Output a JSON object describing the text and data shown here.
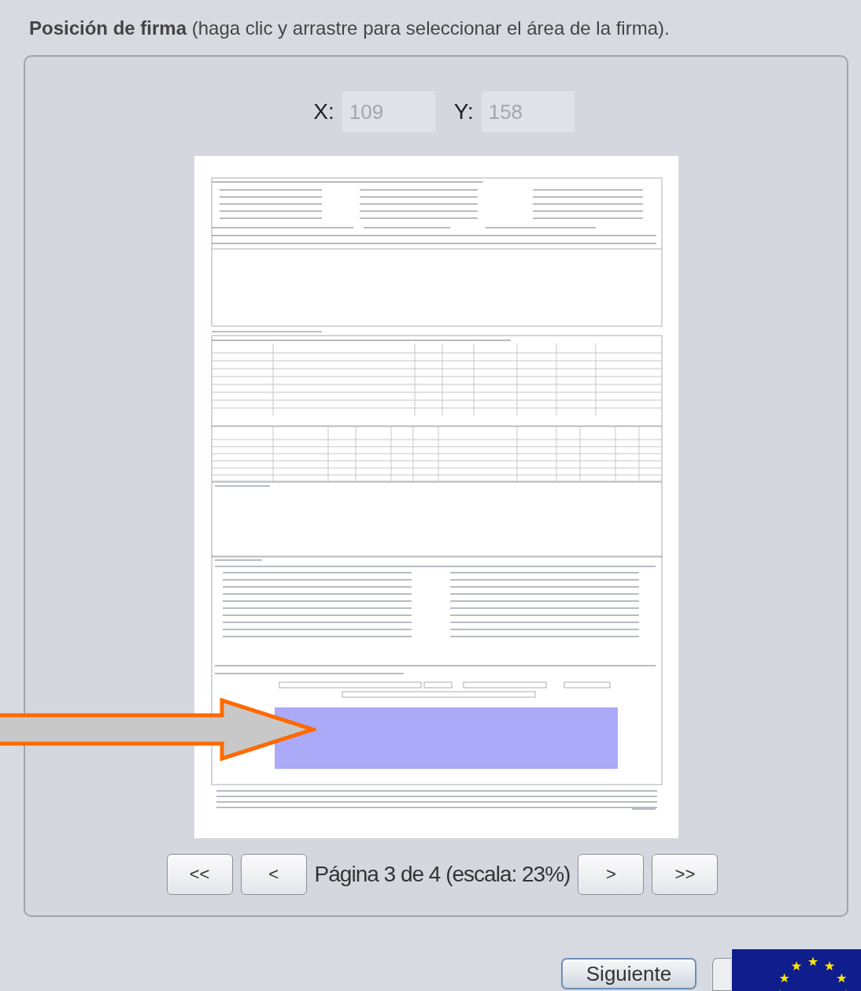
{
  "section_title": "**Posición de firma** (haga clic y arrastre para seleccionar el área de la firma).",
  "coordinates": [
    {
      "label": "X:",
      "value": "109",
      "disabled": true
    },
    {
      "label": "Y:",
      "value": "158",
      "disabled": true
    }
  ],
  "pager": {
    "first": "<<",
    "previous": "<",
    "page_label": "Página 3 de 4 (escala: 23%)",
    "next": ">",
    "last": ">>"
  },
  "buttons": [
    {
      "label": "Siguiente",
      "focused": true
    }
  ]
}
